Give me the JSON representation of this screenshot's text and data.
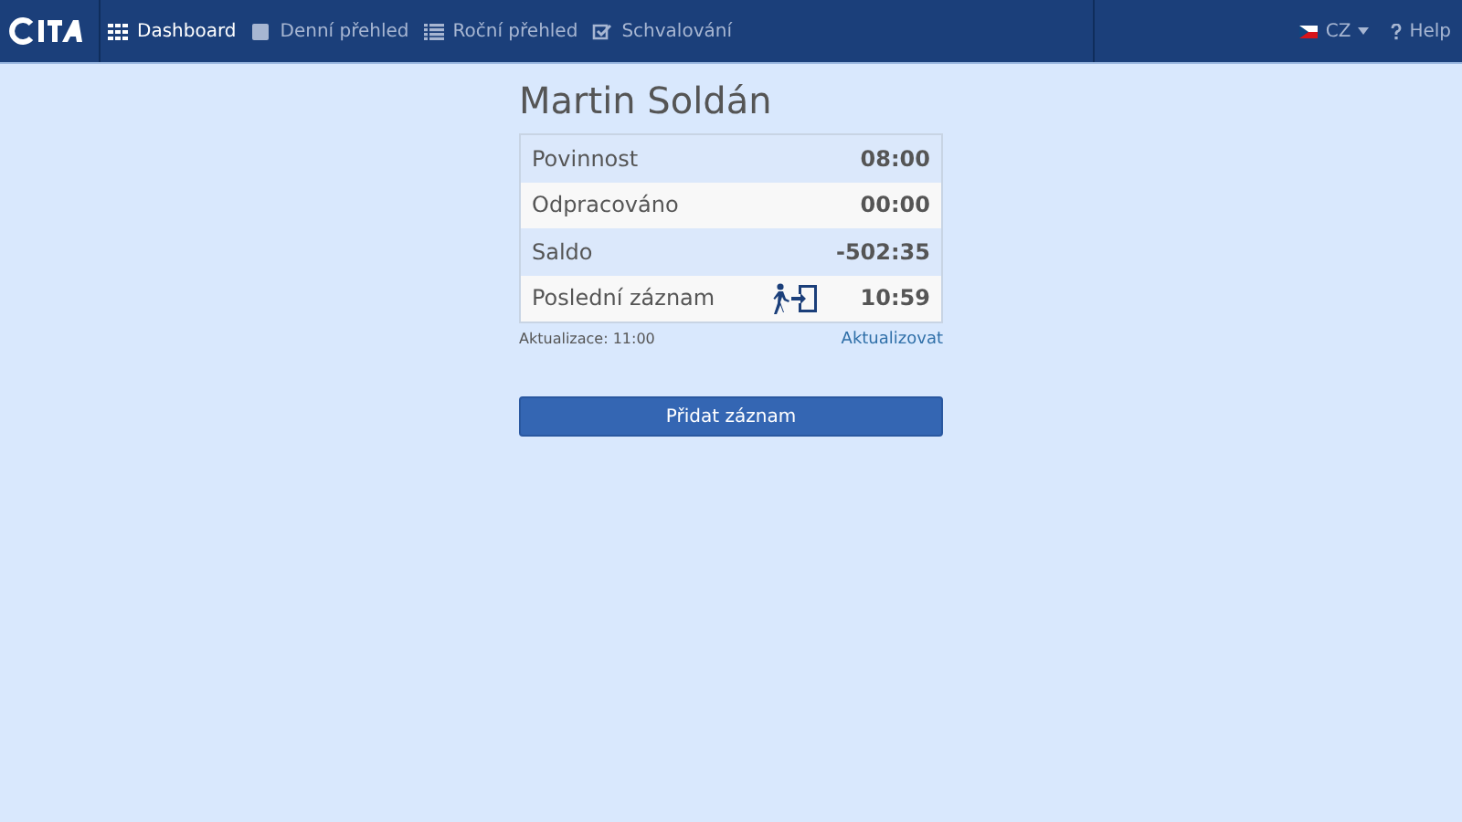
{
  "navbar": {
    "nav_items": [
      {
        "label": "Dashboard",
        "selected": true
      },
      {
        "label": "Denní přehled",
        "selected": false
      },
      {
        "label": "Roční přehled",
        "selected": false
      },
      {
        "label": "Schvalování",
        "selected": false
      }
    ],
    "language": "CZ",
    "help": "Help"
  },
  "user_name": "Martin Soldán",
  "summary_rows": [
    {
      "label": "Povinnost",
      "value": "08:00",
      "kind": "plain"
    },
    {
      "label": "Odpracováno",
      "value": "00:00",
      "kind": "plain"
    },
    {
      "label": "Saldo",
      "value": "-502:35",
      "kind": "plain"
    },
    {
      "label": "Poslední záznam",
      "value": "10:59",
      "kind": "entry"
    }
  ],
  "updated": "Aktualizace: 11:00",
  "refresh_link": "Aktualizovat",
  "add_button": "Přidat záznam"
}
